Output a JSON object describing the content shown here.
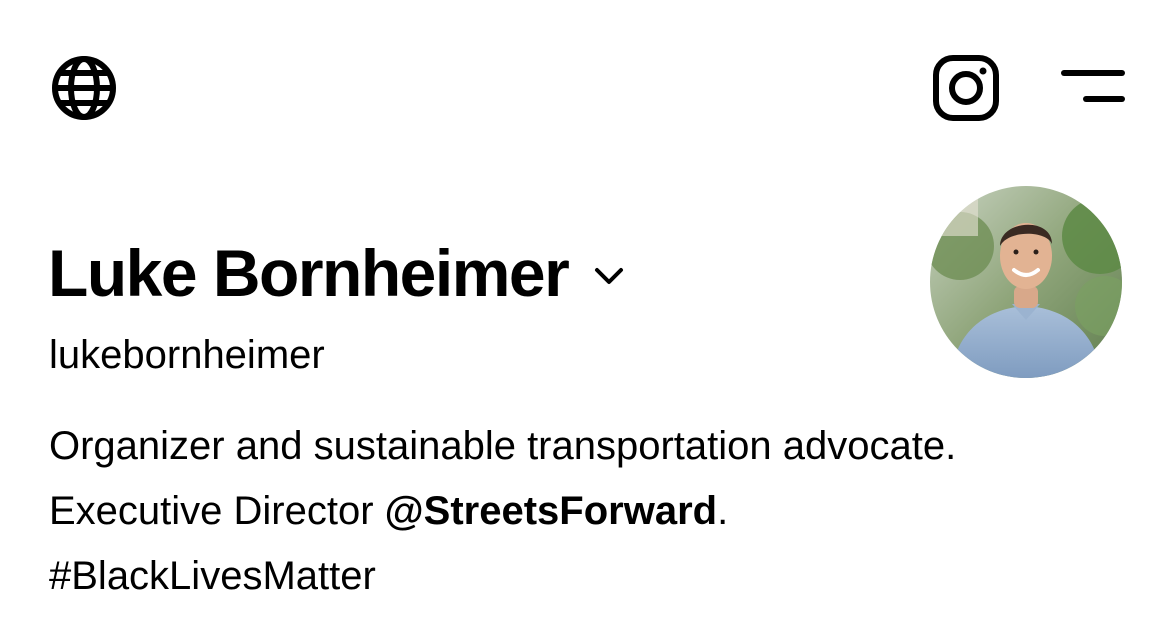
{
  "header": {
    "left_icon": "globe-icon",
    "right_icons": [
      "instagram-icon",
      "menu-icon"
    ]
  },
  "profile": {
    "display_name": "Luke Bornheimer",
    "username": "lukebornheimer",
    "avatar_icon": "profile-photo",
    "bio": {
      "line1": "Organizer and sustainable transportation advocate.",
      "line2_prefix": "Executive Director ",
      "line2_mention": "@StreetsForward",
      "line2_suffix": ".",
      "line3_hashtag": "#BlackLivesMatter"
    }
  },
  "colors": {
    "text": "#000000",
    "background": "#ffffff"
  }
}
